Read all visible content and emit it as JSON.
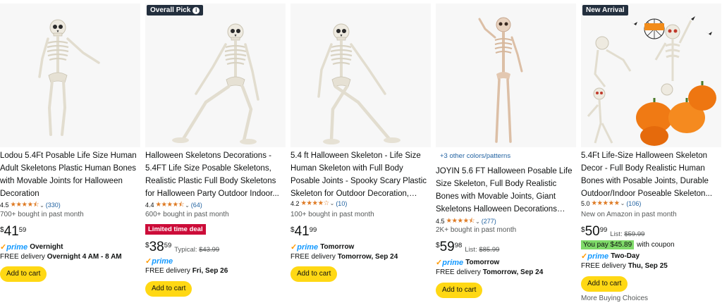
{
  "products": [
    {
      "title": "Lodou 5.4Ft Posable Life Size Human Adult Skeletons Plastic Human Bones with Movable Joints for Halloween Decoration",
      "rating": "4.5",
      "stars": "★★★★⯪",
      "reviews": "(330)",
      "bought": "700+ bought in past month",
      "currency": "$",
      "price_whole": "41",
      "price_frac": "59",
      "prime_label": "prime",
      "prime_speed": "Overnight",
      "delivery_prefix": "FREE delivery ",
      "delivery_date": "Overnight 4 AM - 8 AM",
      "cart_label": "Add to cart"
    },
    {
      "badge": "Overall Pick",
      "badge_icon": "info-icon",
      "title": "Halloween Skeletons Decorations - 5.4FT Life Size Posable Skeletons, Realistic Plastic Full Body Skeletons for Halloween Party Outdoor Indoor...",
      "rating": "4.4",
      "stars": "★★★★⯪",
      "reviews": "(64)",
      "bought": "600+ bought in past month",
      "deal": "Limited time deal",
      "currency": "$",
      "price_whole": "38",
      "price_frac": "59",
      "typical_label": "Typical: ",
      "typical_price": "$43.99",
      "prime_label": "prime",
      "delivery_prefix": "FREE delivery ",
      "delivery_date": "Fri, Sep 26",
      "cart_label": "Add to cart"
    },
    {
      "title": "5.4 ft Halloween Skeleton - Life Size Human Skeleton with Full Body Posable Joints - Spooky Scary Plastic Skeleton for Outdoor Decoration, Party...",
      "rating": "4.2",
      "stars": "★★★★☆",
      "reviews": "(10)",
      "bought": "100+ bought in past month",
      "currency": "$",
      "price_whole": "41",
      "price_frac": "99",
      "prime_label": "prime",
      "prime_speed": "Tomorrow",
      "delivery_prefix": "FREE delivery ",
      "delivery_date": "Tomorrow, Sep 24",
      "cart_label": "Add to cart"
    },
    {
      "variants": "+3 other colors/patterns",
      "title": "JOYIN 5.6 FT Halloween Posable Life Size Skeleton, Full Body Realistic Bones with Movable Joints, Giant Skeletons Halloween Decorations for...",
      "rating": "4.5",
      "stars": "★★★★⯪",
      "reviews": "(277)",
      "bought": "2K+ bought in past month",
      "currency": "$",
      "price_whole": "59",
      "price_frac": "98",
      "list_label": "List: ",
      "list_price": "$85.99",
      "prime_label": "prime",
      "prime_speed": "Tomorrow",
      "delivery_prefix": "FREE delivery ",
      "delivery_date": "Tomorrow, Sep 24",
      "cart_label": "Add to cart"
    },
    {
      "badge": "New Arrival",
      "title": "5.4Ft Life-Size Halloween Skeleton Decor - Full Body Realistic Human Bones with Posable Joints, Durable Outdoor/Indoor Poseable Skeleton...",
      "rating": "5.0",
      "stars": "★★★★★",
      "reviews": "(106)",
      "bought": "New on Amazon in past month",
      "currency": "$",
      "price_whole": "50",
      "price_frac": "99",
      "list_label": "List: ",
      "list_price": "$59.99",
      "coupon_tag": "You pay $45.89",
      "coupon_text": "with coupon",
      "prime_label": "prime",
      "prime_speed": "Two-Day",
      "delivery_prefix": "FREE delivery ",
      "delivery_date": "Thu, Sep 25",
      "cart_label": "Add to cart",
      "more": "More Buying Choices"
    }
  ],
  "colors": {
    "cart": "#ffd814",
    "deal": "#cc0c39",
    "prime": "#1399ff",
    "stars": "#de7921",
    "coupon": "#7fda69",
    "link": "#2162a1"
  }
}
